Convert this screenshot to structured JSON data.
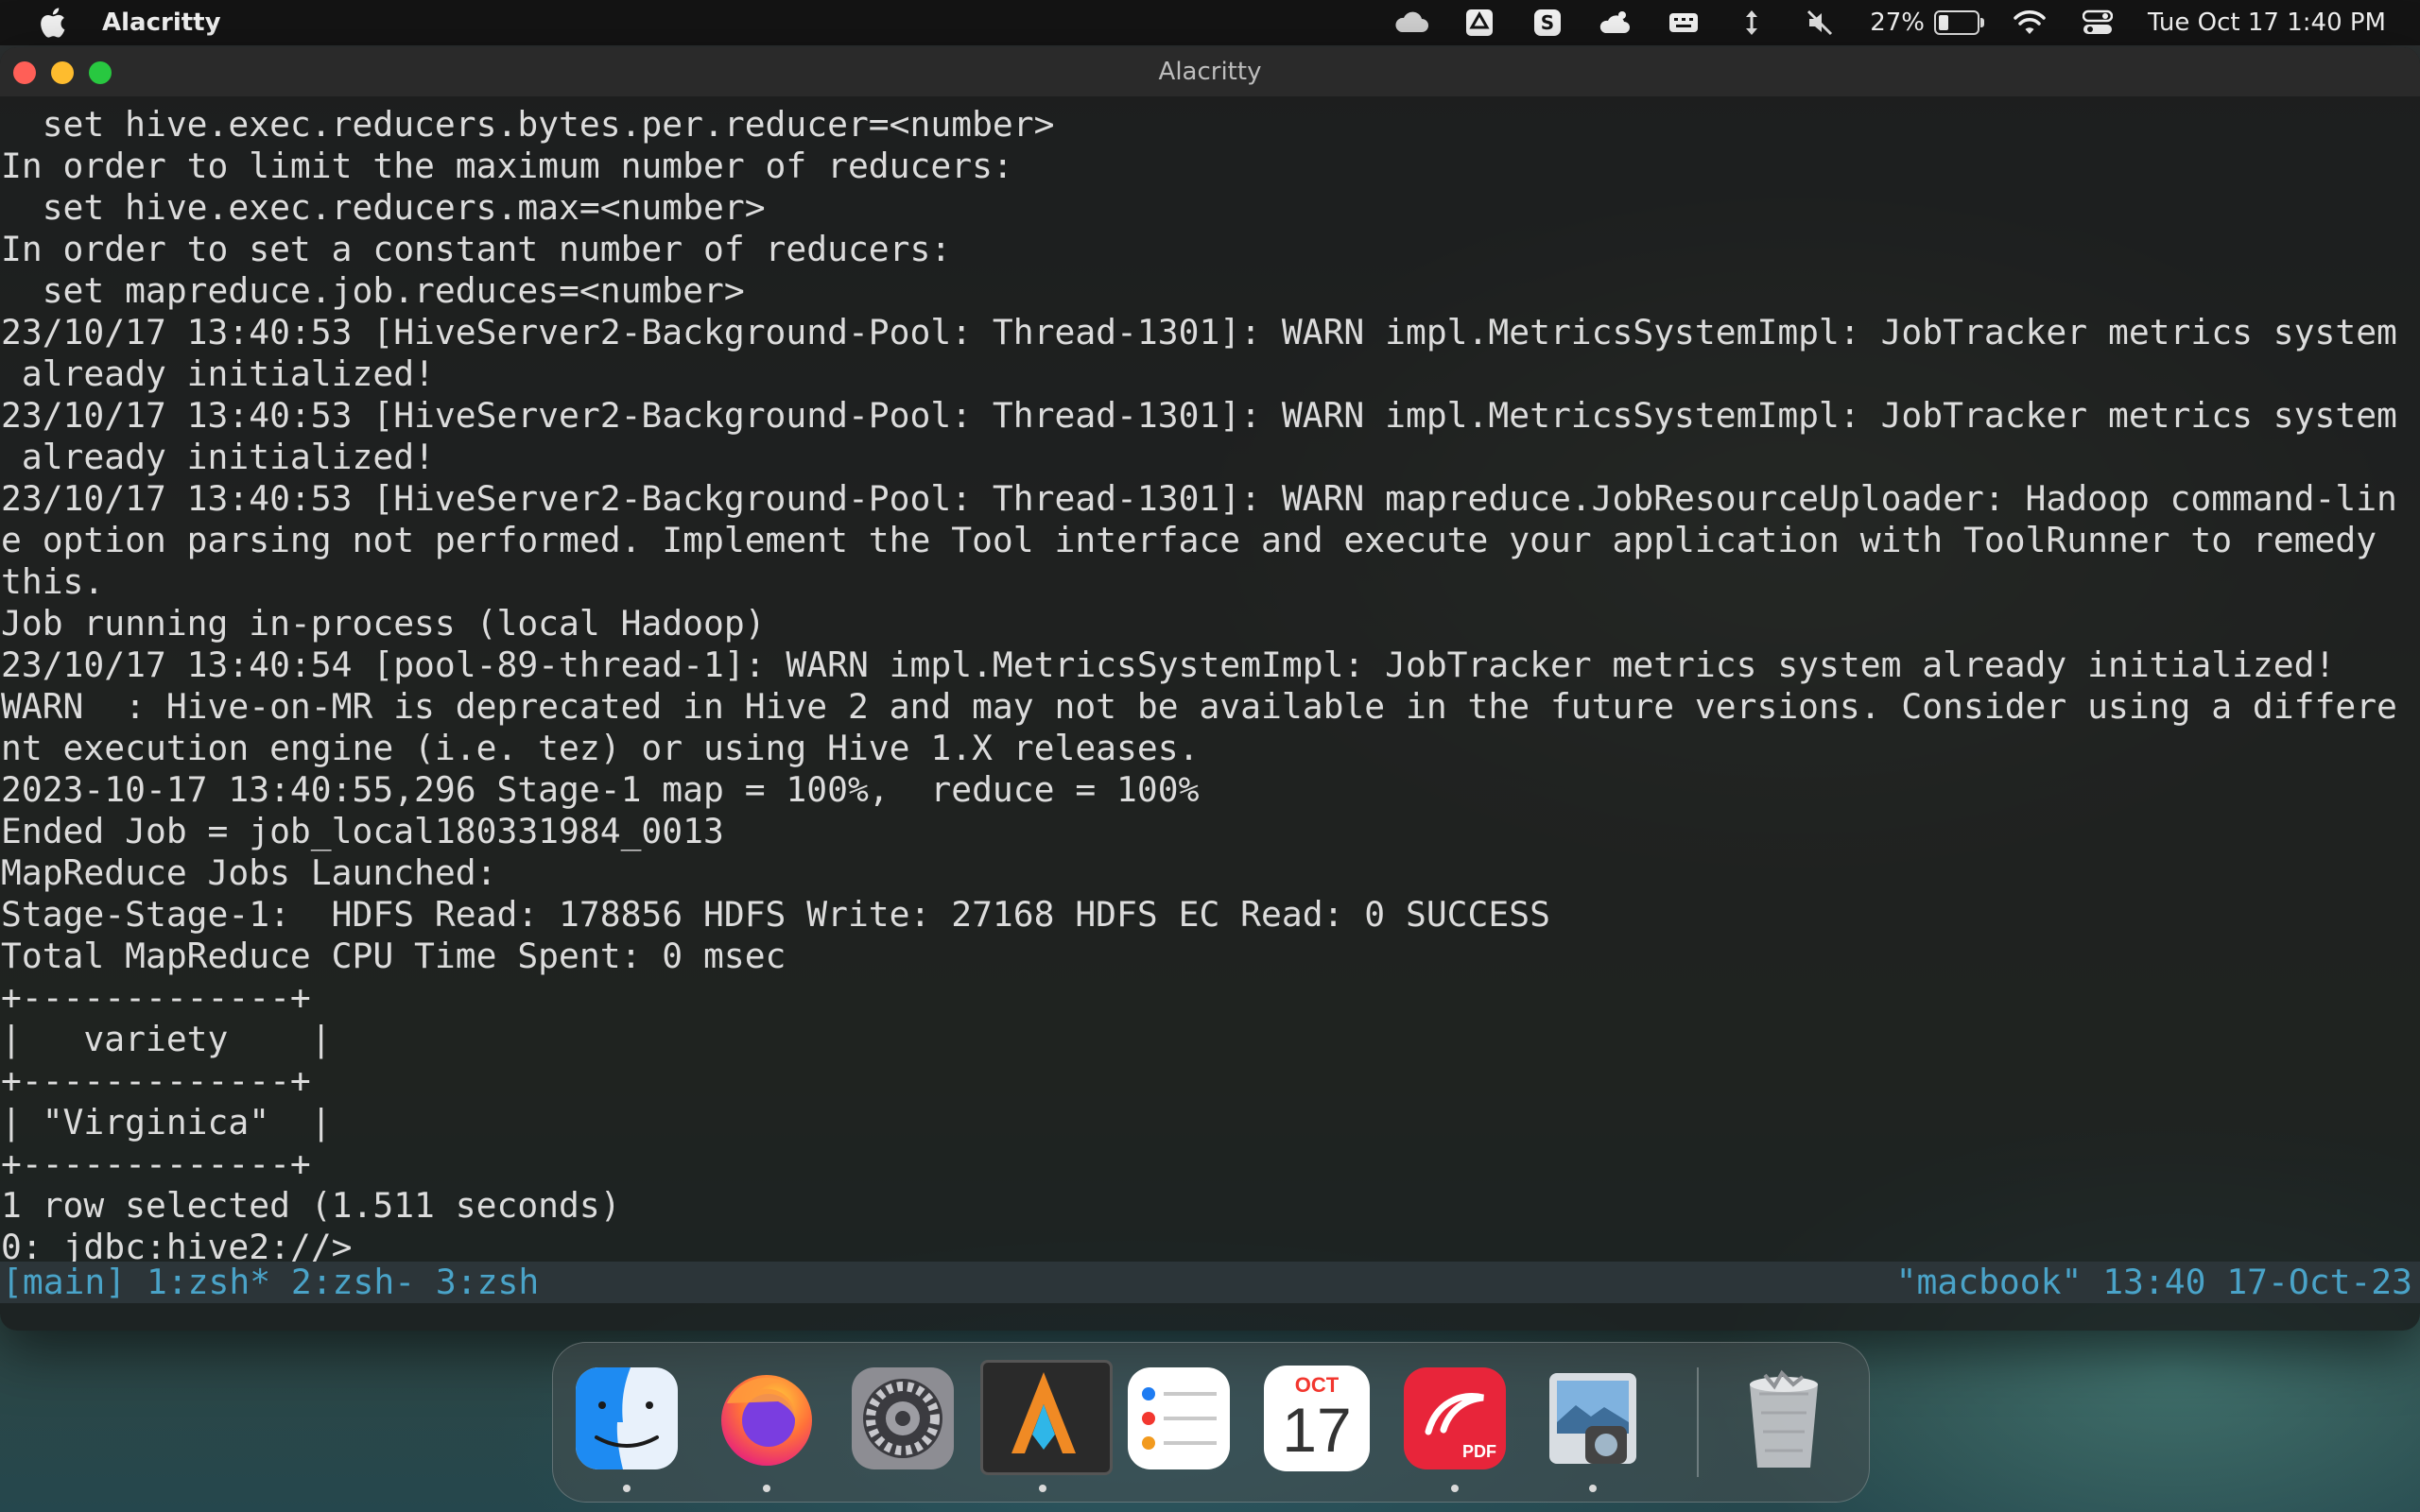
{
  "menubar": {
    "app_name": "Alacritty",
    "battery_percent": "27%",
    "battery_level": 0.27,
    "datetime": "Tue Oct 17  1:40 PM",
    "icons": [
      "apple-icon",
      "cloud-icon",
      "drive-icon",
      "s-app-icon",
      "cloud-bird-icon",
      "keyboard-icon",
      "arrows-icon",
      "mute-icon",
      "battery-icon",
      "wifi-icon",
      "control-center-icon"
    ]
  },
  "window": {
    "title": "Alacritty"
  },
  "terminal": {
    "lines": [
      "  set hive.exec.reducers.bytes.per.reducer=<number>",
      "In order to limit the maximum number of reducers:",
      "  set hive.exec.reducers.max=<number>",
      "In order to set a constant number of reducers:",
      "  set mapreduce.job.reduces=<number>",
      "23/10/17 13:40:53 [HiveServer2-Background-Pool: Thread-1301]: WARN impl.MetricsSystemImpl: JobTracker metrics system",
      " already initialized!",
      "23/10/17 13:40:53 [HiveServer2-Background-Pool: Thread-1301]: WARN impl.MetricsSystemImpl: JobTracker metrics system",
      " already initialized!",
      "23/10/17 13:40:53 [HiveServer2-Background-Pool: Thread-1301]: WARN mapreduce.JobResourceUploader: Hadoop command-lin",
      "e option parsing not performed. Implement the Tool interface and execute your application with ToolRunner to remedy",
      "this.",
      "Job running in-process (local Hadoop)",
      "23/10/17 13:40:54 [pool-89-thread-1]: WARN impl.MetricsSystemImpl: JobTracker metrics system already initialized!",
      "WARN  : Hive-on-MR is deprecated in Hive 2 and may not be available in the future versions. Consider using a differe",
      "nt execution engine (i.e. tez) or using Hive 1.X releases.",
      "2023-10-17 13:40:55,296 Stage-1 map = 100%,  reduce = 100%",
      "Ended Job = job_local180331984_0013",
      "MapReduce Jobs Launched:",
      "Stage-Stage-1:  HDFS Read: 178856 HDFS Write: 27168 HDFS EC Read: 0 SUCCESS",
      "Total MapReduce CPU Time Spent: 0 msec",
      "+-------------+",
      "|   variety    |",
      "+-------------+",
      "| \"Virginica\"  |",
      "+-------------+",
      "1 row selected (1.511 seconds)",
      "0: jdbc:hive2://>"
    ],
    "status_left": "[main] 1:zsh* 2:zsh- 3:zsh",
    "status_right": "\"macbook\" 13:40 17-Oct-23"
  },
  "dock": {
    "apps": [
      {
        "name": "Finder",
        "icon": "finder-icon",
        "running": true
      },
      {
        "name": "Firefox",
        "icon": "firefox-icon",
        "running": true
      },
      {
        "name": "System Settings",
        "icon": "settings-icon",
        "running": false
      },
      {
        "name": "Alacritty",
        "icon": "alacritty-icon",
        "running": true
      },
      {
        "name": "Reminders",
        "icon": "reminders-icon",
        "running": false
      },
      {
        "name": "Calendar",
        "icon": "calendar-icon",
        "running": false
      },
      {
        "name": "PDF Expert",
        "icon": "pdf-icon",
        "running": true
      },
      {
        "name": "Preview",
        "icon": "preview-icon",
        "running": true
      },
      {
        "name": "Trash",
        "icon": "trash-icon",
        "running": false
      }
    ],
    "calendar_month": "OCT",
    "calendar_day": "17",
    "pdf_label": "PDF"
  }
}
